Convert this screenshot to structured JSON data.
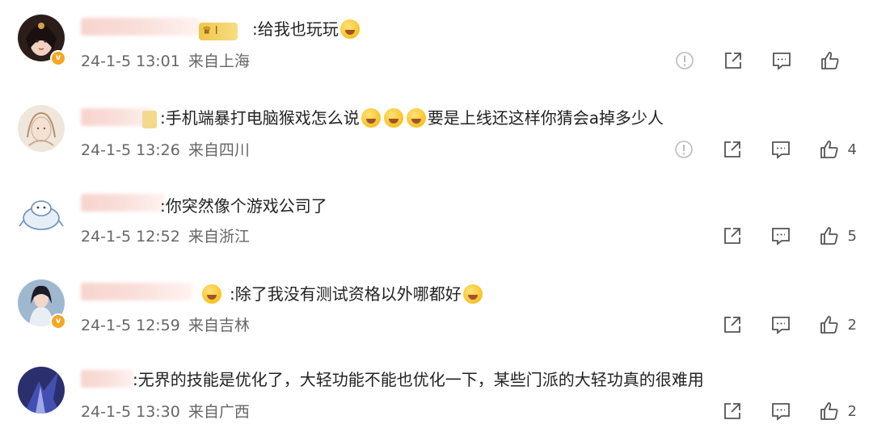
{
  "comments": [
    {
      "text": ":给我也玩玩",
      "emoji_after": [
        "laughing-emoji"
      ],
      "date": "24-1-5 13:01",
      "location": "来自上海",
      "badge_level": "Ⅰ",
      "has_report": true,
      "like_count": ""
    },
    {
      "text_before": ":手机端暴打电脑猴戏怎么说",
      "emojis_mid": [
        "shush-emoji",
        "shush-emoji",
        "shush-emoji"
      ],
      "text_after": "要是上线还这样你猜会a掉多少人",
      "date": "24-1-5 13:26",
      "location": "来自四川",
      "has_report": true,
      "like_count": "4"
    },
    {
      "text": ":你突然像个游戏公司了",
      "date": "24-1-5 12:52",
      "location": "来自浙江",
      "has_report": false,
      "like_count": "5"
    },
    {
      "text": ":除了我没有测试资格以外哪都好",
      "emoji_before": [
        "crying-emoji"
      ],
      "emoji_after": [
        "sweat-emoji"
      ],
      "date": "24-1-5 12:59",
      "location": "来自吉林",
      "has_report": false,
      "like_count": "2"
    },
    {
      "text": ":无界的技能是优化了，大轻功能不能也优化一下，某些门派的大轻功真的很难用",
      "date": "24-1-5 13:30",
      "location": "来自广西",
      "has_report": false,
      "like_count": "2"
    }
  ],
  "colors": {
    "icon": "#555555",
    "text": "#222222",
    "meta": "#666666",
    "vip_badge": "#f5a623",
    "blurred_name": "#f7d2cc"
  },
  "icons": {
    "report": "report-icon",
    "share": "share-icon",
    "comment": "comment-icon",
    "like": "like-icon"
  }
}
